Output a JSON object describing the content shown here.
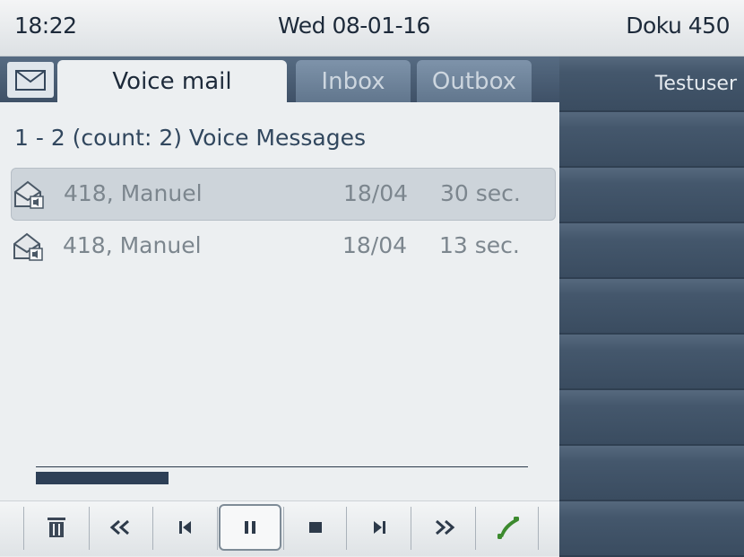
{
  "status_bar": {
    "time": "18:22",
    "date": "Wed 08-01-16",
    "user": "Doku 450"
  },
  "tabs": [
    {
      "label": "Voice mail",
      "active": true
    },
    {
      "label": "Inbox",
      "active": false
    },
    {
      "label": "Outbox",
      "active": false
    }
  ],
  "list": {
    "count_line": "1 - 2 (count: 2) Voice Messages",
    "messages": [
      {
        "name": "418, Manuel",
        "date": "18/04",
        "duration": "30 sec.",
        "selected": true,
        "icon": "voicemail-envelope-icon"
      },
      {
        "name": "418, Manuel",
        "date": "18/04",
        "duration": "13 sec.",
        "selected": false,
        "icon": "voicemail-envelope-icon"
      }
    ]
  },
  "playback": {
    "progress": 0.27
  },
  "controls": [
    {
      "icon": "trash-icon"
    },
    {
      "icon": "rewind-icon"
    },
    {
      "icon": "skip-back-icon"
    },
    {
      "icon": "pause-icon",
      "active": true
    },
    {
      "icon": "stop-icon"
    },
    {
      "icon": "skip-forward-icon"
    },
    {
      "icon": "fast-forward-icon"
    },
    {
      "icon": "call-back-icon"
    }
  ],
  "right_panel": {
    "items": [
      "Testuser",
      "",
      "",
      "",
      "",
      "",
      "",
      "",
      ""
    ]
  },
  "colors": {
    "accent": "#3f5167",
    "panel": "#3b4d61",
    "call_green": "#3c8a2e"
  }
}
